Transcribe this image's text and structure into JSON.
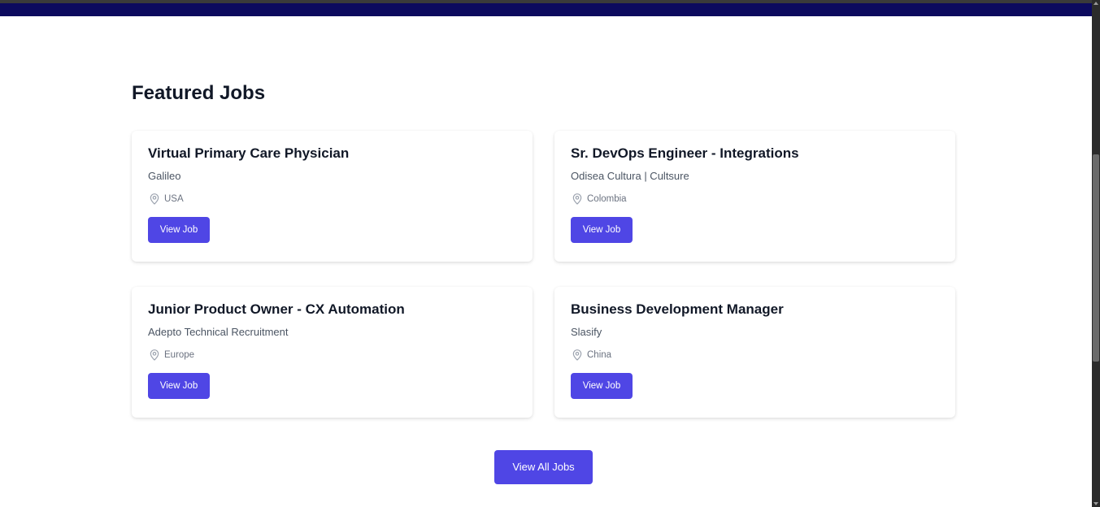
{
  "section": {
    "title": "Featured Jobs"
  },
  "jobs": [
    {
      "title": "Virtual Primary Care Physician",
      "company": "Galileo",
      "location": "USA",
      "button_label": "View Job"
    },
    {
      "title": "Sr. DevOps Engineer - Integrations",
      "company": "Odisea Cultura | Cultsure",
      "location": "Colombia",
      "button_label": "View Job"
    },
    {
      "title": "Junior Product Owner - CX Automation",
      "company": "Adepto Technical Recruitment",
      "location": "Europe",
      "button_label": "View Job"
    },
    {
      "title": "Business Development Manager",
      "company": "Slasify",
      "location": "China",
      "button_label": "View Job"
    }
  ],
  "view_all_label": "View All Jobs",
  "icons": {
    "location": "map-pin-icon"
  },
  "colors": {
    "primary": "#4f46e5",
    "nav": "#0c0a5e",
    "heading": "#111827",
    "muted": "#6b7280"
  }
}
